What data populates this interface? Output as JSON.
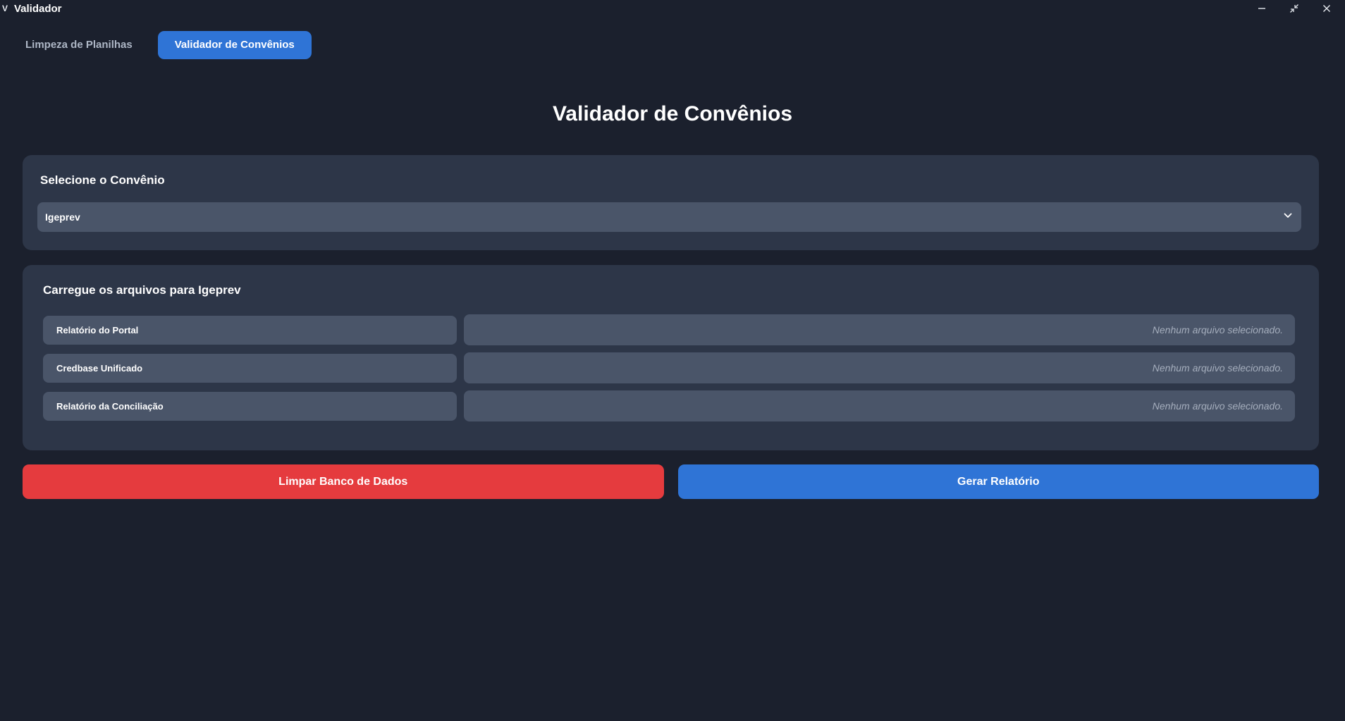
{
  "window": {
    "icon_glyph": "V",
    "title": "Validador"
  },
  "tabs": [
    {
      "label": "Limpeza de Planilhas",
      "active": false
    },
    {
      "label": "Validador de Convênios",
      "active": true
    }
  ],
  "page": {
    "title": "Validador de Convênios"
  },
  "select_section": {
    "heading": "Selecione o Convênio",
    "selected_value": "Igeprev"
  },
  "files_section": {
    "heading": "Carregue os arquivos para Igeprev",
    "files": [
      {
        "label": "Relatório do Portal",
        "status": "Nenhum arquivo selecionado."
      },
      {
        "label": "Credbase Unificado",
        "status": "Nenhum arquivo selecionado."
      },
      {
        "label": "Relatório da Conciliação",
        "status": "Nenhum arquivo selecionado."
      }
    ]
  },
  "actions": {
    "clear_label": "Limpar Banco de Dados",
    "generate_label": "Gerar Relatório"
  },
  "colors": {
    "background": "#1b202d",
    "card": "#2d3648",
    "field": "#4a5569",
    "accent": "#2f74d6",
    "danger": "#e53b3e"
  },
  "icons": {
    "minimize": "minimize-icon",
    "restore": "restore-icon",
    "close": "close-icon",
    "dropdown": "chevron-down-icon"
  }
}
